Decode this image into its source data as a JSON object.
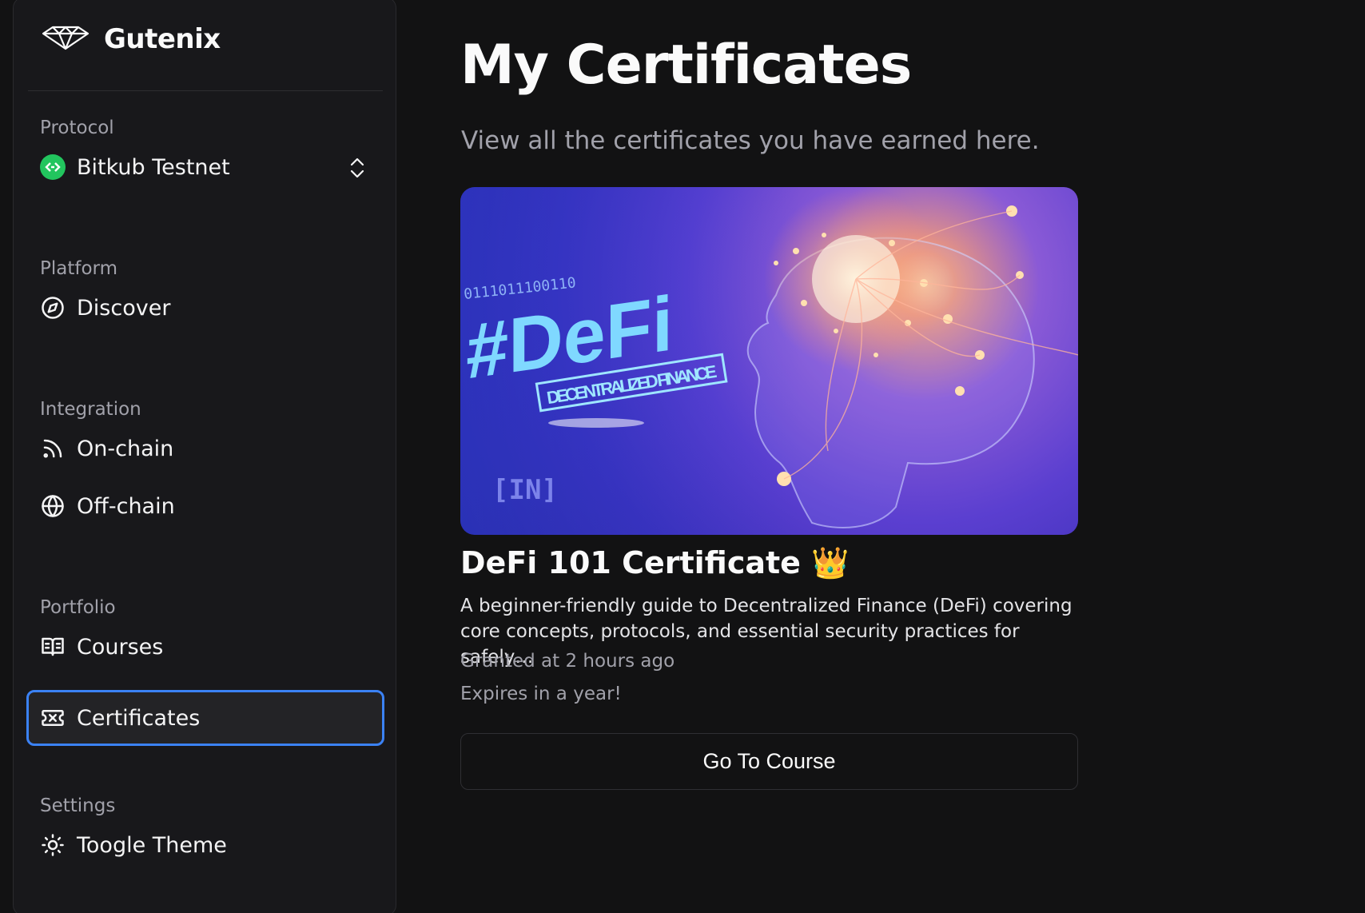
{
  "brand": {
    "name": "Gutenix"
  },
  "sidebar": {
    "protocol": {
      "label": "Protocol",
      "network": "Bitkub Testnet"
    },
    "platform": {
      "label": "Platform",
      "items": [
        {
          "label": "Discover",
          "icon": "compass-icon"
        }
      ]
    },
    "integration": {
      "label": "Integration",
      "items": [
        {
          "label": "On-chain",
          "icon": "rss-icon"
        },
        {
          "label": "Off-chain",
          "icon": "globe-icon"
        }
      ]
    },
    "portfolio": {
      "label": "Portfolio",
      "items": [
        {
          "label": "Courses",
          "icon": "book-open-icon"
        },
        {
          "label": "Certificates",
          "icon": "ticket-icon",
          "active": true
        }
      ]
    },
    "settings": {
      "label": "Settings",
      "items": [
        {
          "label": "Toogle Theme",
          "icon": "sun-icon"
        }
      ]
    }
  },
  "page": {
    "title": "My Certificates",
    "subtitle": "View all the certificates you have earned here."
  },
  "certificate": {
    "image_text": {
      "tag": "#DeFi",
      "banner": "DECENTRALIZED FINANCE",
      "binary": "0111011100110",
      "watermark": "[IN]"
    },
    "title": "DeFi 101 Certificate 👑",
    "description": "A beginner-friendly guide to Decentralized Finance (DeFi) covering core concepts, protocols, and essential security practices for safely…",
    "granted": "Granted at 2 hours ago",
    "expires": "Expires in a year!",
    "button_label": "Go To Course"
  },
  "colors": {
    "active_border": "#3b82f6",
    "protocol_badge": "#22c55e",
    "background": "#121213",
    "sidebar": "#18181b"
  }
}
